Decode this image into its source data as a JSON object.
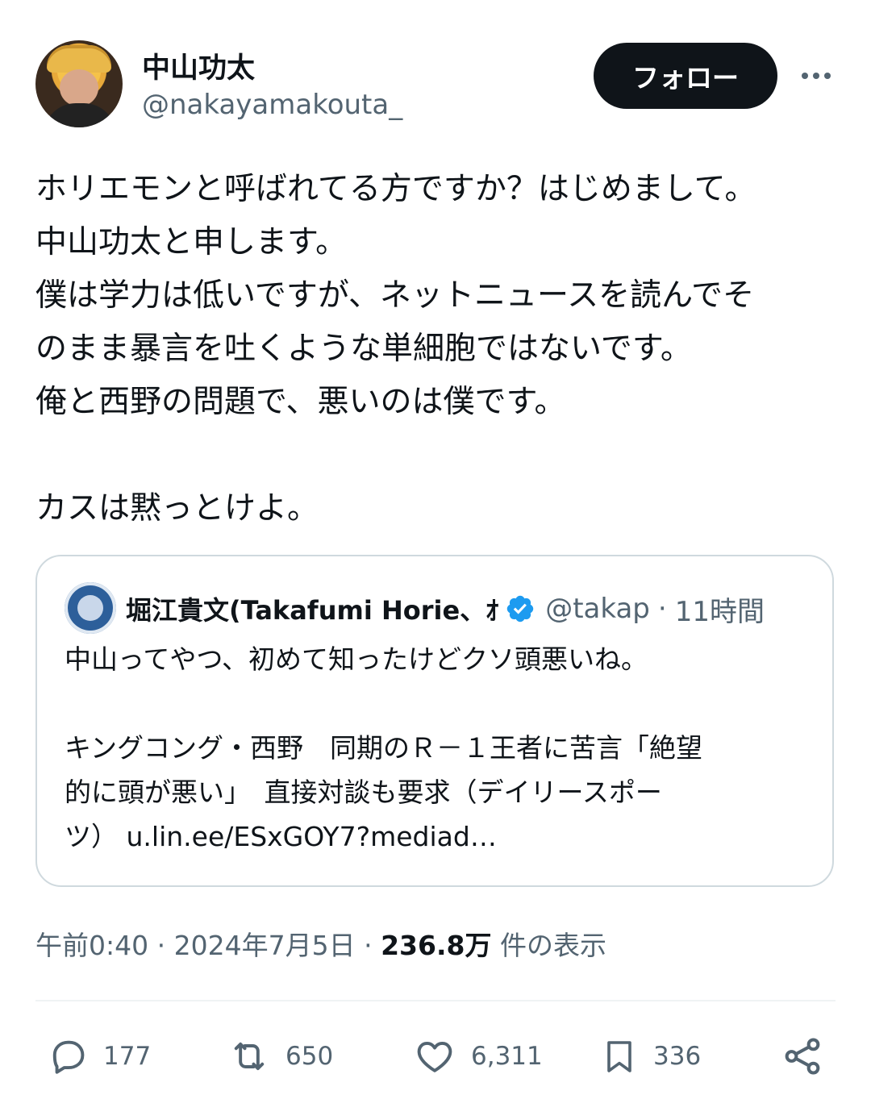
{
  "header": {
    "display_name": "中山功太",
    "handle": "@nakayamakouta_",
    "follow_label": "フォロー",
    "more_icon": "more-horizontal-icon"
  },
  "tweet": {
    "lines": [
      "ホリエモンと呼ばれてる方ですか？はじめまして。",
      "中山功太と申します。",
      "僕は学力は低いですが、ネットニュースを読んでそ",
      "のまま暴言を吐くような単細胞ではないです。",
      "俺と西野の問題で、悪いのは僕です。",
      "",
      "カスは黙っとけよ。"
    ]
  },
  "quote": {
    "name": "堀江貴文(Takafumi Horie、ｵ",
    "verified_icon": "verified-badge-icon",
    "handle": "@takap",
    "separator": "·",
    "time": "11時間",
    "lines": [
      "中山ってやつ、初めて知ったけどクソ頭悪いね。",
      "",
      "キングコング・西野　同期のＲ－１王者に苦言「絶望",
      "的に頭が悪い」　直接対談も要求（デイリースポー",
      "ツ） u.lin.ee/ESxGOY7?mediad…"
    ]
  },
  "meta": {
    "time": "午前0:40",
    "sep1": "·",
    "date": "2024年7月5日",
    "sep2": "·",
    "views_count": "236.8万",
    "views_label": "件の表示"
  },
  "actions": {
    "replies": "177",
    "retweets": "650",
    "likes": "6,311",
    "bookmarks": "336"
  },
  "colors": {
    "text": "#0f1419",
    "secondary": "#536471",
    "border": "#cfd9de",
    "verified": "#1d9bf0",
    "follow_bg": "#0f1419"
  }
}
